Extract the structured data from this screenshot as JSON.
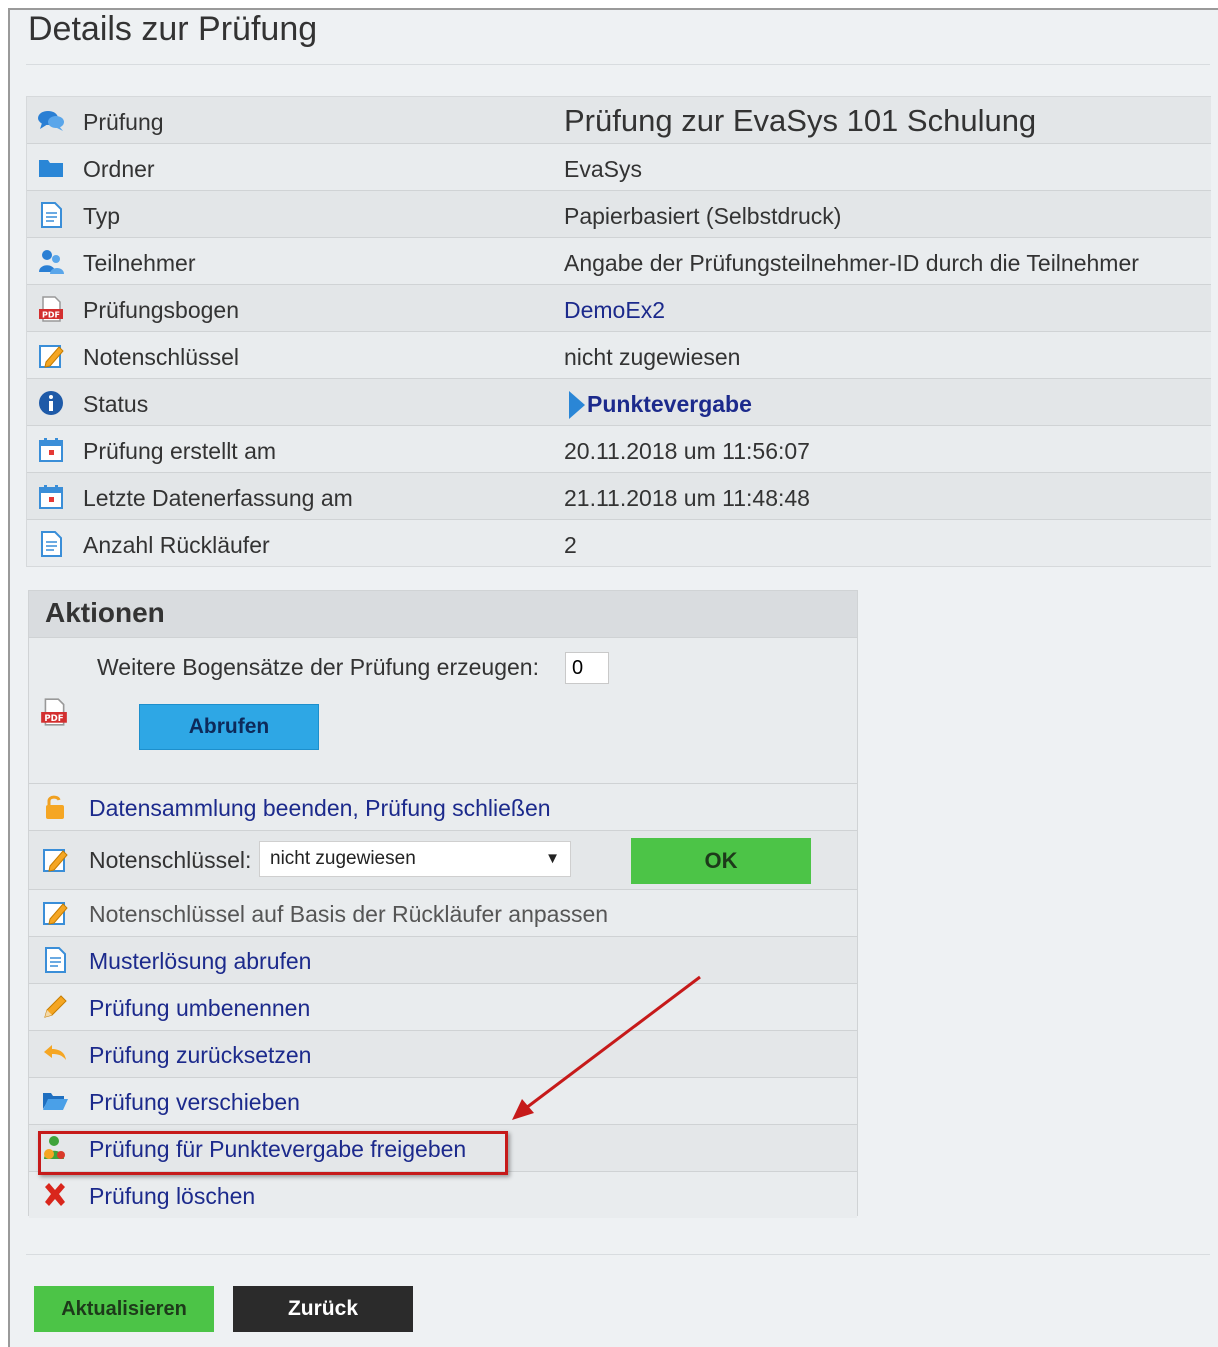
{
  "page": {
    "title": "Details zur Prüfung"
  },
  "details": {
    "rows": [
      {
        "icon": "speech-bubbles-icon",
        "label": "Prüfung",
        "value": "Prüfung zur EvaSys 101 Schulung"
      },
      {
        "icon": "folder-icon",
        "label": "Ordner",
        "value": "EvaSys"
      },
      {
        "icon": "document-icon",
        "label": "Typ",
        "value": "Papierbasiert (Selbstdruck)"
      },
      {
        "icon": "users-icon",
        "label": "Teilnehmer",
        "value": "Angabe der Prüfungsteilnehmer-ID durch die Teilnehmer"
      },
      {
        "icon": "pdf-icon",
        "label": "Prüfungsbogen",
        "value": "DemoEx2"
      },
      {
        "icon": "edit-icon",
        "label": "Notenschlüssel",
        "value": "nicht zugewiesen"
      },
      {
        "icon": "info-icon",
        "label": "Status",
        "value": "Punktevergabe"
      },
      {
        "icon": "calendar-icon",
        "label": "Prüfung erstellt am",
        "value": "20.11.2018 um 11:56:07"
      },
      {
        "icon": "calendar-icon",
        "label": "Letzte Datenerfassung am",
        "value": "21.11.2018 um 11:48:48"
      },
      {
        "icon": "document-icon",
        "label": "Anzahl Rückläufer",
        "value": "2"
      }
    ]
  },
  "actions": {
    "heading": "Aktionen",
    "generate": {
      "label": "Weitere Bogensätze der Prüfung erzeugen:",
      "input_value": "0",
      "button": "Abrufen"
    },
    "close_label": "Datensammlung beenden, Prüfung schließen",
    "grade_key": {
      "label": "Notenschlüssel:",
      "selected": "nicht zugewiesen",
      "button": "OK"
    },
    "adjust_label": "Notenschlüssel auf Basis der Rückläufer anpassen",
    "solution_label": "Musterlösung abrufen",
    "rename_label": "Prüfung umbenennen",
    "reset_label": "Prüfung zurücksetzen",
    "move_label": "Prüfung verschieben",
    "release_label": "Prüfung für Punktevergabe freigeben",
    "delete_label": "Prüfung löschen"
  },
  "footer": {
    "refresh": "Aktualisieren",
    "back": "Zurück"
  },
  "colors": {
    "link": "#1c2a8c",
    "button_blue": "#2ea7e5",
    "button_green": "#4cc447",
    "button_dark": "#2b2b2b",
    "highlight": "#c61a1a"
  }
}
